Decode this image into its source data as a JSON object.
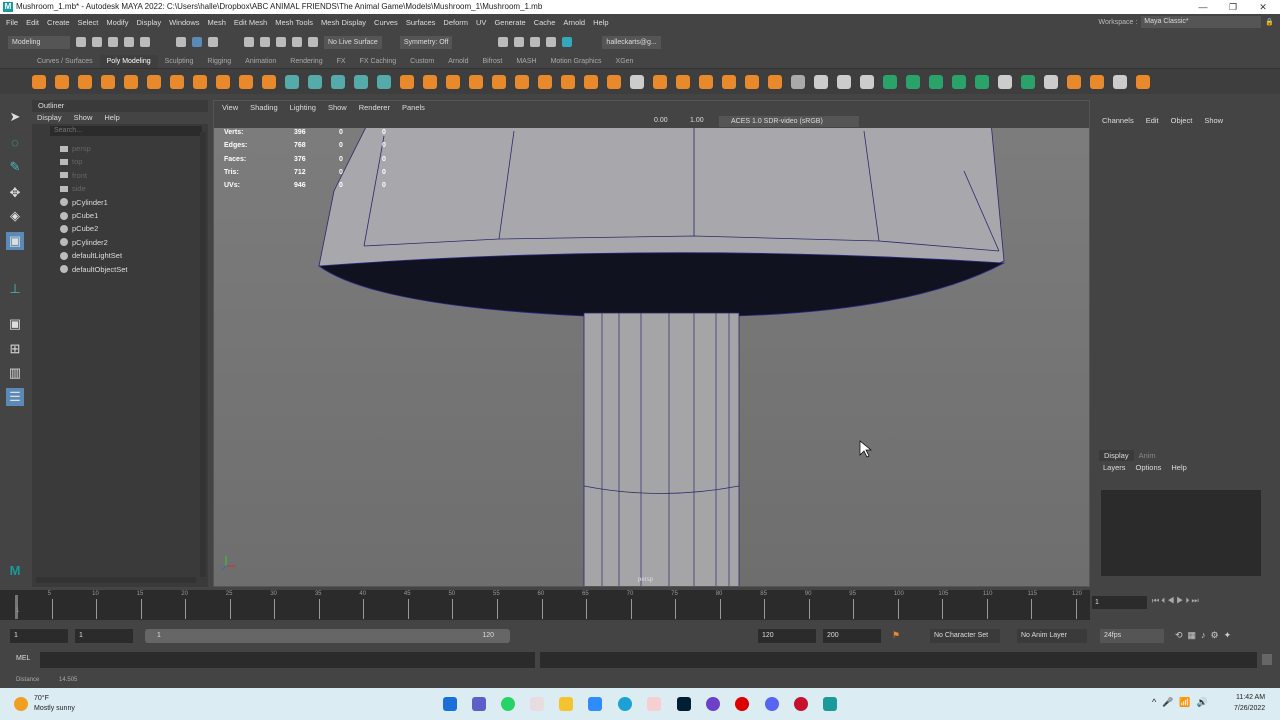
{
  "window": {
    "title": "Mushroom_1.mb* - Autodesk MAYA 2022: C:\\Users\\halle\\Dropbox\\ABC ANIMAL FRIENDS\\The Animal Game\\Models\\Mushroom_1\\Mushroom_1.mb",
    "minimize": "—",
    "maximize": "❐",
    "close": "✕"
  },
  "menubar": [
    "File",
    "Edit",
    "Create",
    "Select",
    "Modify",
    "Display",
    "Windows",
    "Mesh",
    "Edit Mesh",
    "Mesh Tools",
    "Mesh Display",
    "Curves",
    "Surfaces",
    "Deform",
    "UV",
    "Generate",
    "Cache",
    "Arnold",
    "Help"
  ],
  "workspace": {
    "label": "Workspace :",
    "value": "Maya Classic*"
  },
  "statusline": {
    "mode": "Modeling",
    "live_surface": "No Live Surface",
    "symmetry": "Symmetry: Off",
    "account": "halleckarts@g..."
  },
  "shelf_tabs": [
    "Curves / Surfaces",
    "Poly Modeling",
    "Sculpting",
    "Rigging",
    "Animation",
    "Rendering",
    "FX",
    "FX Caching",
    "Custom",
    "Arnold",
    "Bifrost",
    "MASH",
    "Motion Graphics",
    "XGen"
  ],
  "shelf_active": "Poly Modeling",
  "outliner": {
    "title": "Outliner",
    "menu": [
      "Display",
      "Show",
      "Help"
    ],
    "search_placeholder": "Search...",
    "items": [
      {
        "name": "persp",
        "type": "camera",
        "dim": true
      },
      {
        "name": "top",
        "type": "camera",
        "dim": true
      },
      {
        "name": "front",
        "type": "camera",
        "dim": true
      },
      {
        "name": "side",
        "type": "camera",
        "dim": true
      },
      {
        "name": "pCylinder1",
        "type": "mesh"
      },
      {
        "name": "pCube1",
        "type": "mesh"
      },
      {
        "name": "pCube2",
        "type": "mesh"
      },
      {
        "name": "pCylinder2",
        "type": "mesh"
      },
      {
        "name": "defaultLightSet",
        "type": "set"
      },
      {
        "name": "defaultObjectSet",
        "type": "set"
      }
    ]
  },
  "viewport": {
    "menu": [
      "View",
      "Shading",
      "Lighting",
      "Show",
      "Renderer",
      "Panels"
    ],
    "exposure": "0.00",
    "gamma": "1.00",
    "color_space": "ACES 1.0 SDR-video (sRGB)",
    "camera_label": "persp",
    "hud": [
      {
        "label": "Verts:",
        "a": "396",
        "b": "0",
        "c": "0"
      },
      {
        "label": "Edges:",
        "a": "768",
        "b": "0",
        "c": "0"
      },
      {
        "label": "Faces:",
        "a": "376",
        "b": "0",
        "c": "0"
      },
      {
        "label": "Tris:",
        "a": "712",
        "b": "0",
        "c": "0"
      },
      {
        "label": "UVs:",
        "a": "946",
        "b": "0",
        "c": "0"
      }
    ]
  },
  "channelbox": {
    "menu": [
      "Channels",
      "Edit",
      "Object",
      "Show"
    ],
    "layer_tabs": [
      "Display",
      "Anim"
    ],
    "layer_menu": [
      "Layers",
      "Options",
      "Help"
    ]
  },
  "timeline": {
    "ticks": [
      "5",
      "10",
      "15",
      "20",
      "25",
      "30",
      "35",
      "40",
      "45",
      "50",
      "55",
      "60",
      "65",
      "70",
      "75",
      "80",
      "85",
      "90",
      "95",
      "100",
      "105",
      "110",
      "115",
      "120"
    ],
    "current_frame": "1",
    "frame_field": "1"
  },
  "range": {
    "start": "1",
    "anim_start": "1",
    "slider_start": "1",
    "slider_end": "120",
    "end": "120",
    "anim_end": "200",
    "character_set": "No Character Set",
    "anim_layer": "No Anim Layer",
    "fps": "24fps"
  },
  "command": {
    "label": "MEL"
  },
  "helpline": {
    "label": "Distance",
    "value": "14.505"
  },
  "taskbar": {
    "weather_temp": "70°F",
    "weather_desc": "Mostly sunny",
    "time": "11:42 AM",
    "date": "7/26/2022"
  }
}
